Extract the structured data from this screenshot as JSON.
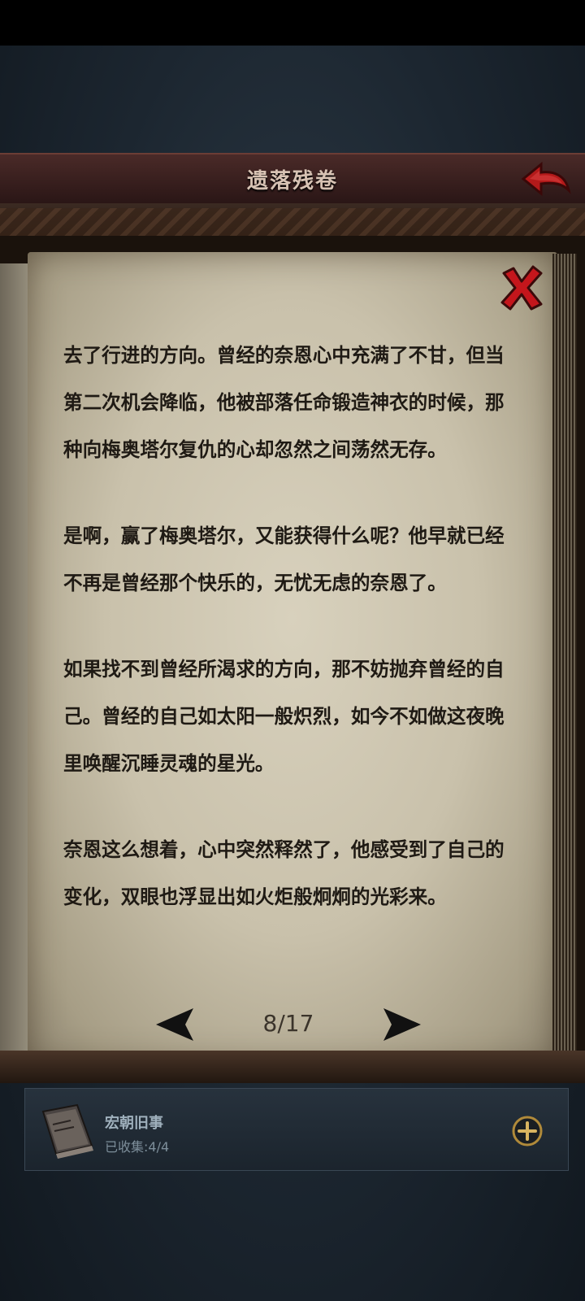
{
  "header": {
    "title": "遗落残卷"
  },
  "page": {
    "paragraphs": [
      "去了行进的方向。曾经的奈恩心中充满了不甘，但当第二次机会降临，他被部落任命锻造神衣的时候，那种向梅奥塔尔复仇的心却忽然之间荡然无存。",
      "是啊，赢了梅奥塔尔，又能获得什么呢？他早就已经不再是曾经那个快乐的，无忧无虑的奈恩了。",
      "如果找不到曾经所渴求的方向，那不妨抛弃曾经的自己。曾经的自己如太阳一般炽烈，如今不如做这夜晚里唤醒沉睡灵魂的星光。",
      "奈恩这么想着，心中突然释然了，他感受到了自己的变化，双眼也浮显出如火炬般炯炯的光彩来。"
    ]
  },
  "pager": {
    "label": "8/17",
    "current": 8,
    "total": 17
  },
  "collection": {
    "title": "宏朝旧事",
    "count_label": "已收集:",
    "count_value": "4/4"
  },
  "icons": {
    "back": "back-arrow-icon",
    "close": "close-x-icon",
    "prev": "left-triangle-icon",
    "next": "right-triangle-icon",
    "book": "book-icon",
    "add": "plus-circle-icon"
  },
  "colors": {
    "header_bg": "#3a201e",
    "paper": "#cfc8b3",
    "text": "#1f1a14",
    "close_red": "#c4161c",
    "back_red": "#b31a1a",
    "panel_bg": "#212a33"
  }
}
